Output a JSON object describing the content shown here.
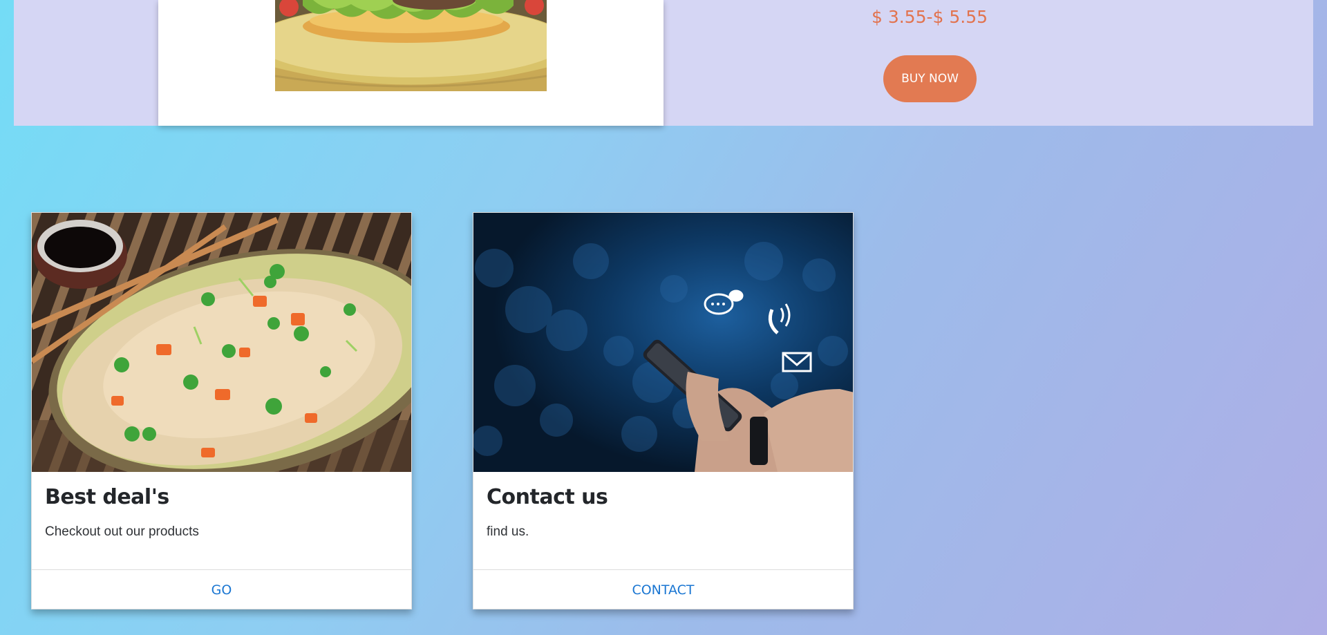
{
  "product": {
    "image_name": "burger-image",
    "price": "$ 3.55-$ 5.55",
    "buy_label": "BUY NOW"
  },
  "cards": [
    {
      "image_name": "fried-rice-image",
      "title": "Best deal's",
      "text": "Checkout out our products",
      "link_label": "GO"
    },
    {
      "image_name": "phone-contact-image",
      "title": "Contact us",
      "text": "find us.",
      "link_label": "CONTACT"
    }
  ],
  "colors": {
    "accent_orange": "#e27a52",
    "price_orange": "#e2734e",
    "link_blue": "#1a76d2",
    "strip_lavender": "#d5d6f4"
  }
}
